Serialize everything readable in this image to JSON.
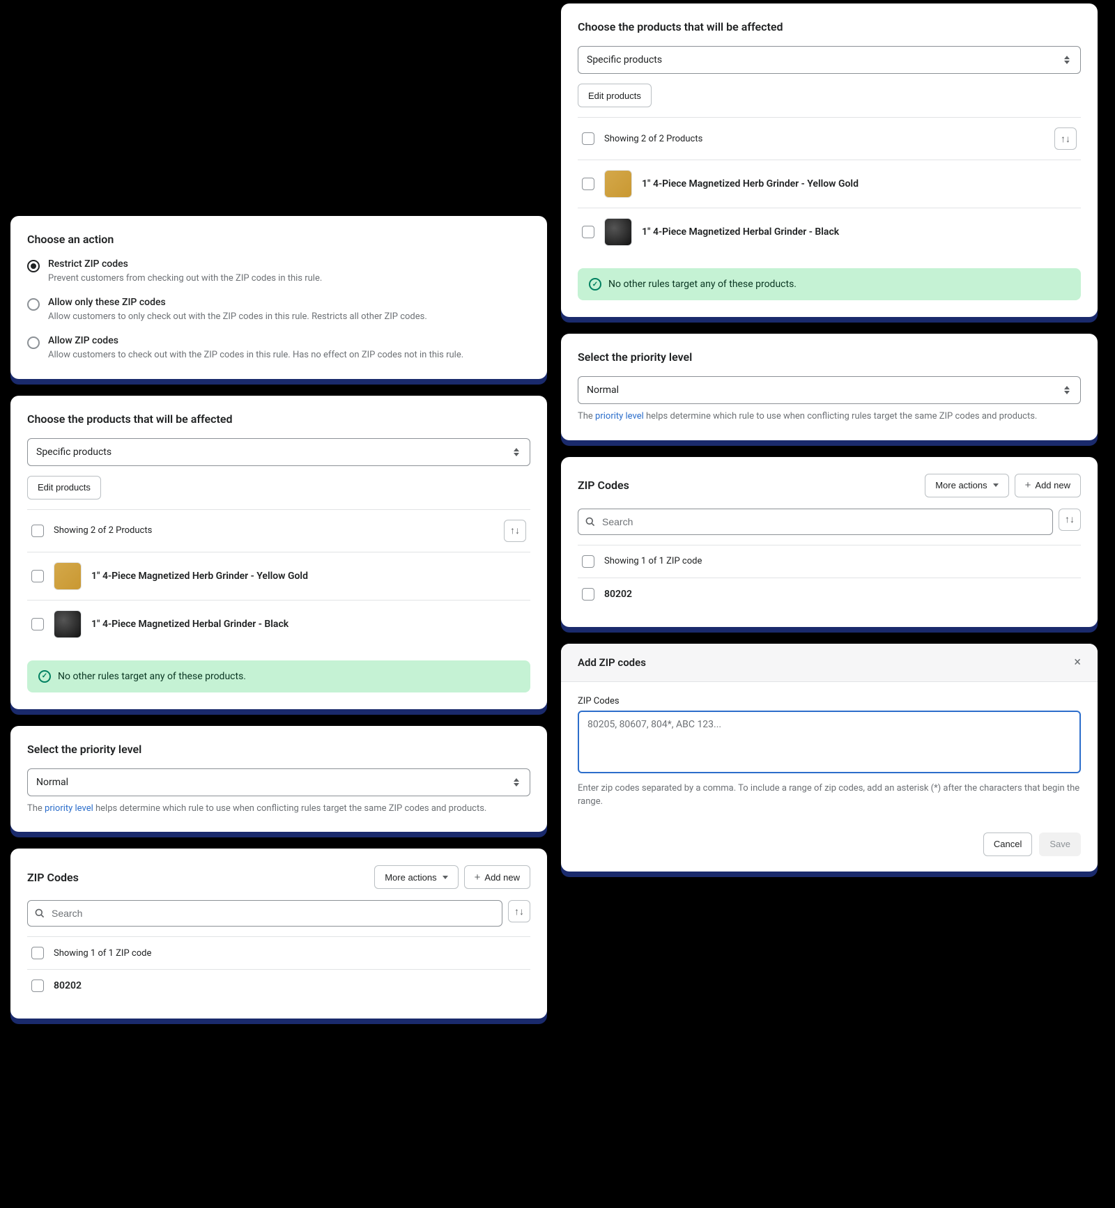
{
  "action_card": {
    "title": "Choose an action",
    "options": [
      {
        "label": "Restrict ZIP codes",
        "desc": "Prevent customers from checking out with the ZIP codes in this rule.",
        "selected": true
      },
      {
        "label": "Allow only these ZIP codes",
        "desc": "Allow customers to only check out with the ZIP codes in this rule. Restricts all other ZIP codes.",
        "selected": false
      },
      {
        "label": "Allow ZIP codes",
        "desc": "Allow customers to check out with the ZIP codes in this rule. Has no effect on ZIP codes not in this rule.",
        "selected": false
      }
    ]
  },
  "products_card": {
    "title": "Choose the products that will be affected",
    "select_value": "Specific products",
    "edit_btn": "Edit products",
    "count_text": "Showing 2 of 2 Products",
    "products": [
      {
        "name": "1\" 4-Piece Magnetized Herb Grinder - Yellow Gold",
        "thumb": "yellow"
      },
      {
        "name": "1\" 4-Piece Magnetized Herbal Grinder - Black",
        "thumb": "black"
      }
    ],
    "banner_text": "No other rules target any of these products."
  },
  "priority_card": {
    "title": "Select the priority level",
    "select_value": "Normal",
    "help_pre": "The ",
    "help_link": "priority level",
    "help_post": " helps determine which rule to use when conflicting rules target the same ZIP codes and products."
  },
  "zip_card": {
    "title": "ZIP Codes",
    "more_btn": "More actions",
    "add_btn": "Add new",
    "search_placeholder": "Search",
    "count_text": "Showing 1 of 1 ZIP code",
    "codes": [
      {
        "value": "80202"
      }
    ]
  },
  "modal": {
    "title": "Add ZIP codes",
    "field_label": "ZIP Codes",
    "placeholder": "80205, 80607, 804*, ABC 123...",
    "helper": "Enter zip codes separated by a comma. To include a range of zip codes, add an asterisk (*) after the characters that begin the range.",
    "cancel": "Cancel",
    "save": "Save"
  }
}
